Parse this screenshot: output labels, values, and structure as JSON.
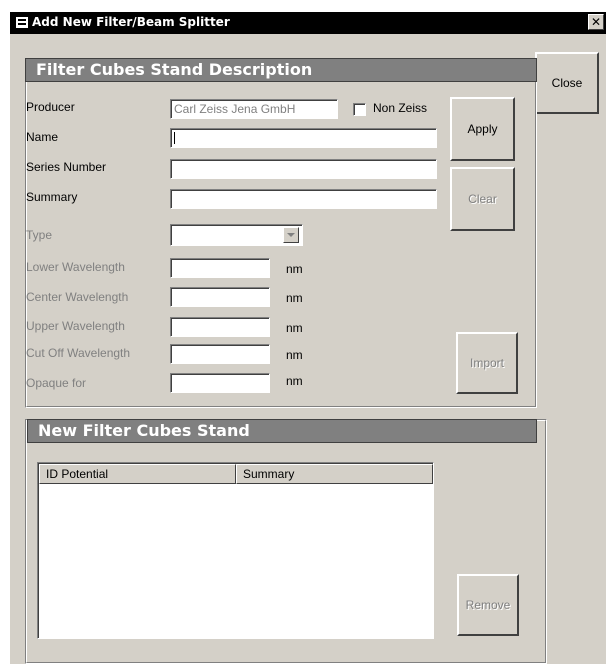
{
  "window": {
    "title": "Add New Filter/Beam Splitter",
    "close_glyph": "✕"
  },
  "buttons": {
    "close": "Close",
    "apply": "Apply",
    "clear": "Clear",
    "import": "Import",
    "remove": "Remove"
  },
  "description": {
    "header": "Filter Cubes Stand Description",
    "producer_label": "Producer",
    "producer_value": "Carl Zeiss Jena GmbH",
    "non_zeiss_label": "Non Zeiss",
    "non_zeiss_checked": false,
    "name_label": "Name",
    "name_value": "",
    "series_label": "Series Number",
    "series_value": "",
    "summary_label": "Summary",
    "summary_value": "",
    "type_label": "Type",
    "type_value": "",
    "lower_label": "Lower Wavelength",
    "center_label": "Center Wavelength",
    "upper_label": "Upper Wavelength",
    "cutoff_label": "Cut Off Wavelength",
    "opaque_label": "Opaque for",
    "unit": "nm"
  },
  "stand_list": {
    "header": "New Filter Cubes Stand",
    "columns": [
      "ID Potential",
      "Summary"
    ],
    "rows": []
  },
  "icons": {
    "window": "window-icon",
    "dropdown": "chevron-down-icon",
    "close": "close-icon"
  },
  "colors": {
    "face": "#d4d0c8",
    "header": "#808080",
    "titlebar": "#000000",
    "disabled_text": "#808080"
  }
}
